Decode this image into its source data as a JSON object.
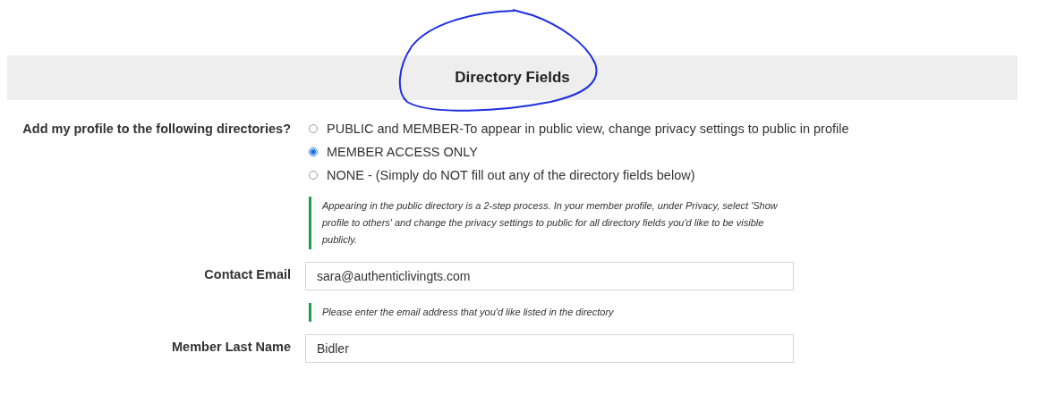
{
  "section": {
    "title": "Directory Fields"
  },
  "directories": {
    "label": "Add my profile to the following directories?",
    "options": [
      {
        "label": "PUBLIC and MEMBER-To appear in public view, change privacy settings to public in profile",
        "selected": false
      },
      {
        "label": "MEMBER ACCESS ONLY",
        "selected": true
      },
      {
        "label": "NONE - (Simply do NOT fill out any of the directory fields below)",
        "selected": false
      }
    ],
    "note": "Appearing in the public directory is a 2-step process. In your member profile, under Privacy, select 'Show profile to others' and change the privacy settings to public for all directory fields you'd like to be visible publicly."
  },
  "fields": [
    {
      "label": "Contact Email",
      "value": "sara@authenticlivingts.com",
      "note": "Please enter the email address that you'd like listed in the directory"
    },
    {
      "label": "Member Last Name",
      "value": "Bidler"
    }
  ]
}
